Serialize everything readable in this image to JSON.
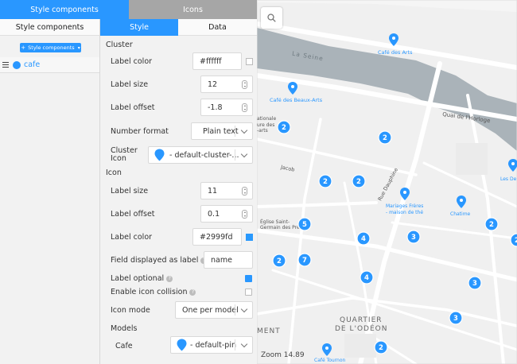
{
  "top_tabs": {
    "style_components": "Style components",
    "icons": "Icons"
  },
  "left": {
    "title": "Style components",
    "add_button": "Style components",
    "layers": [
      {
        "name": "cafe",
        "color": "#2997ff"
      }
    ]
  },
  "sub_tabs": {
    "style": "Style",
    "data": "Data"
  },
  "cluster": {
    "heading": "Cluster",
    "label_color": {
      "label": "Label color",
      "value": "#ffffff"
    },
    "label_size": {
      "label": "Label size",
      "value": "12"
    },
    "label_offset": {
      "label": "Label offset",
      "value": "-1.8"
    },
    "number_format": {
      "label": "Number format",
      "value": "Plain text"
    },
    "cluster_icon": {
      "label": "Cluster Icon",
      "value": "- default-cluster-..."
    }
  },
  "icon": {
    "heading": "Icon",
    "label_size": {
      "label": "Label size",
      "value": "11"
    },
    "label_offset": {
      "label": "Label offset",
      "value": "0.1"
    },
    "label_color": {
      "label": "Label color",
      "value": "#2999fd"
    },
    "field_displayed": {
      "label": "Field displayed as label",
      "value": "name"
    },
    "label_optional": {
      "label": "Label optional",
      "checked": true
    },
    "enable_collision": {
      "label": "Enable icon collision",
      "checked": false
    },
    "icon_mode": {
      "label": "Icon mode",
      "value": "One per model"
    }
  },
  "models": {
    "heading": "Models",
    "cafe": {
      "label": "Cafe",
      "value": "- default-pin"
    }
  },
  "map": {
    "zoom_text": "Zoom 14.89",
    "labels": {
      "seine": "La Seine",
      "cafe_arts": "Café des Arts",
      "cafe_beaux_arts": "Café des Beaux-Arts",
      "nationale": "ationale",
      "beaux": "ure des",
      "arts": "-arts",
      "quai": "Quai de l'Horloge",
      "jacob": "Jacob",
      "dauphine": "Rue Dauphine",
      "mariages": "Mariages Frères",
      "maison": "- maison de thé",
      "chatime": "Chatime",
      "les_de": "Les De",
      "eglise": "Église Saint-",
      "germain": "Germain des Prés",
      "quartier": "QUARTIER",
      "odeon": "DE L'ODÉON",
      "ment": "MENT",
      "cafe_tournon": "Café Tournon"
    },
    "clusters": [
      "2",
      "2",
      "2",
      "2",
      "5",
      "4",
      "7",
      "3",
      "2",
      "2",
      "4",
      "3",
      "3",
      "2",
      "2"
    ]
  },
  "colors": {
    "accent": "#2997ff",
    "tab_inactive": "#a6a6a6",
    "water": "#aab3b9",
    "street": "#ffffff"
  }
}
